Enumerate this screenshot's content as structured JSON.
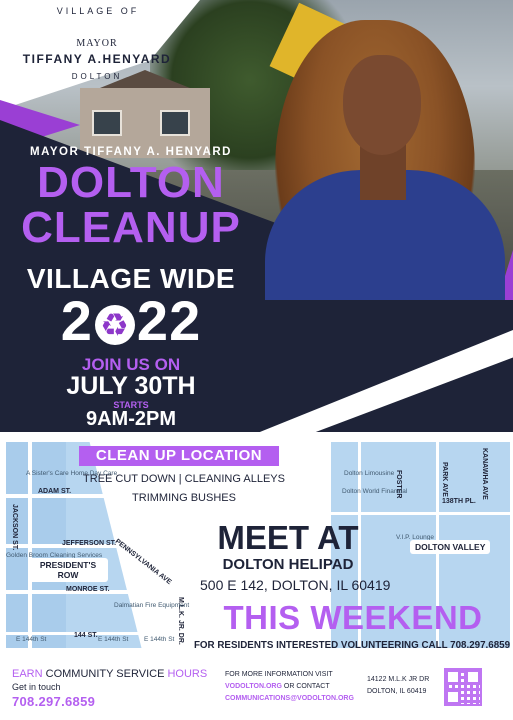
{
  "logo": {
    "village_of": "VILLAGE OF",
    "mayor": "MAYOR",
    "name": "TIFFANY A.HENYARD",
    "town": "DOLTON"
  },
  "headline": {
    "mayor_line": "MAYOR TIFFANY A. HENYARD",
    "dolton": "DOLTON",
    "cleanup": "CLEANUP",
    "village_wide": "VILLAGE WIDE",
    "year_left": "2",
    "year_right": "22",
    "recycle_glyph": "♻",
    "join_us": "JOIN US ON",
    "date": "JULY 30TH",
    "starts": "STARTS",
    "time": "9AM-2PM"
  },
  "location": {
    "title": "CLEAN UP LOCATION",
    "line1": "TREE CUT DOWN | CLEANING ALLEYS",
    "line2": "TRIMMING BUSHES"
  },
  "map": {
    "streets": {
      "adam": "ADAM ST.",
      "jackson": "JACKSON ST.",
      "jefferson": "JEFFERSON ST.",
      "monroe": "MONROE ST.",
      "pennsylvania": "PENNSYLVANIA AVE",
      "mlk": "M.L.K. JR. DR.",
      "st144": "144 ST.",
      "foster": "FOSTER",
      "park": "PARK AVE",
      "kanawha": "KANAWHA AVE",
      "st138": "138TH PL."
    },
    "badges": {
      "presidents_row": "PRESIDENT'S ROW",
      "dolton_valley": "DOLTON VALLEY"
    },
    "poi": {
      "care": "A Sister's Care Home Day Care",
      "golden": "Golden Broom Cleaning Services",
      "dalmatian": "Dalmatian Fire Equipment",
      "limousine": "Dolton Limousine",
      "world": "Dolton World Financial",
      "vip": "V.I.P. Lounge",
      "e144a": "E 144th St",
      "e144b": "E 144th St",
      "e144c": "E 144th St"
    }
  },
  "meet": {
    "title": "MEET AT",
    "place": "DOLTON HELIPAD",
    "address": "500 E 142, DOLTON, IL 60419"
  },
  "weekend": {
    "title": "THIS WEEKEND",
    "volunteer": "FOR RESIDENTS INTERESTED VOLUNTEERING CALL 708.297.6859"
  },
  "footer": {
    "earn": "EARN",
    "community": "COMMUNITY SERVICE",
    "hours": "HOURS",
    "get_in_touch": "Get in touch",
    "phone": "708.297.6859",
    "info_line1": "FOR MORE INFORMATION VISIT",
    "website": "VODOLTON.ORG",
    "or_contact": "OR CONTACT",
    "email": "COMMUNICATIONS@VODOLTON.ORG",
    "address1": "14122 M.L.K JR DR",
    "address2": "DOLTON, IL 60419"
  },
  "colors": {
    "purple": "#b45ff0",
    "navy": "#1e2338",
    "map_blue": "#b7d6f0"
  }
}
